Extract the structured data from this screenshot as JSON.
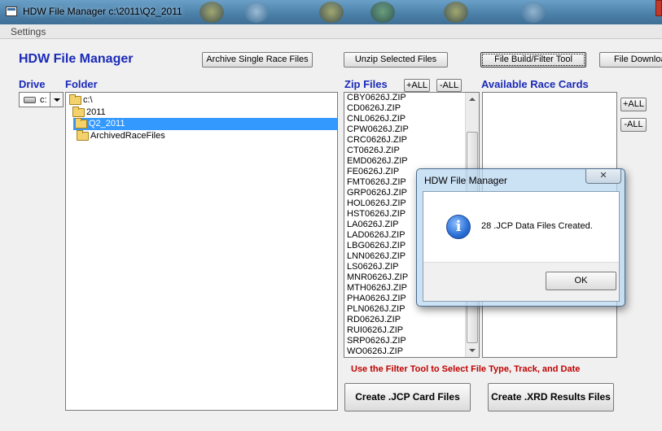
{
  "window": {
    "title": "HDW File Manager c:\\2011\\Q2_2011"
  },
  "menu": {
    "settings": "Settings"
  },
  "app_heading": "HDW File Manager",
  "toolbar": {
    "archive": "Archive Single Race Files",
    "unzip": "Unzip Selected Files",
    "filter_tool": "File Build/Filter Tool",
    "download": "File Download"
  },
  "labels": {
    "drive": "Drive",
    "folder": "Folder",
    "zip_files": "Zip Files",
    "race_cards": "Available Race Cards"
  },
  "drive_select": {
    "value": "c:"
  },
  "folders": [
    {
      "name": "c:\\"
    },
    {
      "name": "2011"
    },
    {
      "name": "Q2_2011"
    },
    {
      "name": "ArchivedRaceFiles"
    }
  ],
  "zip_buttons": {
    "add_all": "+ALL",
    "remove_all": "-ALL"
  },
  "race_buttons": {
    "add_all": "+ALL",
    "remove_all": "-ALL"
  },
  "zip_files": [
    "CBY0626J.ZIP",
    "CD0626J.ZIP",
    "CNL0626J.ZIP",
    "CPW0626J.ZIP",
    "CRC0626J.ZIP",
    "CT0626J.ZIP",
    "EMD0626J.ZIP",
    "FE0626J.ZIP",
    "FMT0626J.ZIP",
    "GRP0626J.ZIP",
    "HOL0626J.ZIP",
    "HST0626J.ZIP",
    "LA0626J.ZIP",
    "LAD0626J.ZIP",
    "LBG0626J.ZIP",
    "LNN0626J.ZIP",
    "LS0626J.ZIP",
    "MNR0626J.ZIP",
    "MTH0626J.ZIP",
    "PHA0626J.ZIP",
    "PLN0626J.ZIP",
    "RD0626J.ZIP",
    "RUI0626J.ZIP",
    "SRP0626J.ZIP",
    "WO0626J.ZIP"
  ],
  "filter_note": "Use the Filter Tool to Select File Type, Track, and Date",
  "actions": {
    "create_jcp": "Create .JCP Card Files",
    "create_xrd": "Create .XRD Results Files"
  },
  "dialog": {
    "title": "HDW File Manager",
    "close": "✕",
    "message": "28 .JCP Data Files Created.",
    "ok": "OK",
    "icon_glyph": "i"
  }
}
